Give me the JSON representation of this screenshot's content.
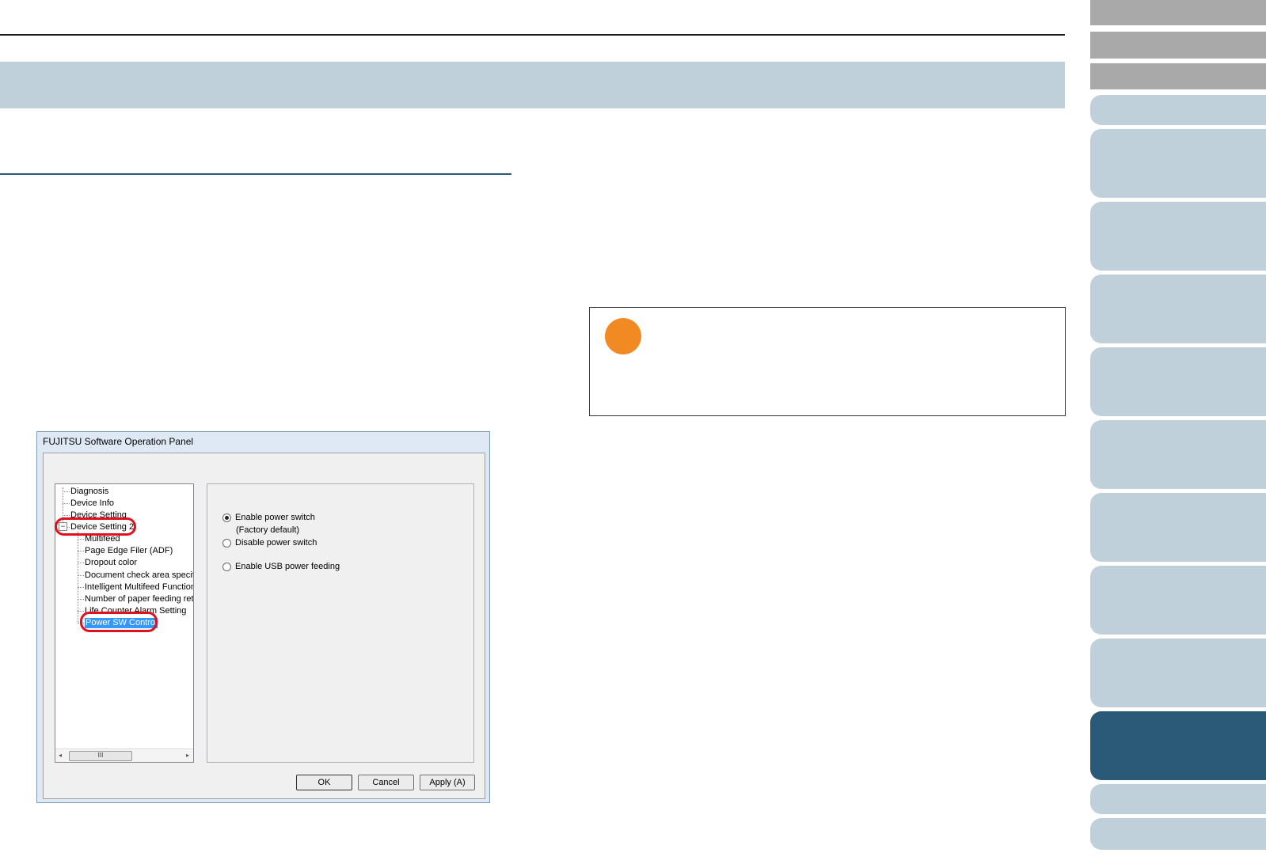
{
  "dialog": {
    "title": "FUJITSU Software Operation Panel",
    "tree_items": [
      "Diagnosis",
      "Device Info",
      "Device Setting",
      "Device Setting 2",
      "Multifeed",
      "Page Edge Filer (ADF)",
      "Dropout color",
      "Document check area specific",
      "Intelligent Multifeed Function",
      "Number of paper feeding retrie",
      "Life Counter Alarm Setting",
      "Power SW Control"
    ],
    "expander": "−",
    "scroll_thumb": "III",
    "scroll_left": "◂",
    "scroll_right": "▸",
    "options": {
      "enable_power_switch": "Enable power switch",
      "factory_default": "(Factory default)",
      "disable_power_switch": "Disable power switch",
      "enable_usb_power_feeding": "Enable USB power feeding"
    },
    "selected_option": "enable_power_switch",
    "buttons": {
      "ok": "OK",
      "cancel": "Cancel",
      "apply": "Apply (A)"
    }
  },
  "colors": {
    "band": "#bfd0da",
    "active_tab": "#2b5a78",
    "note_icon": "#f28a24",
    "highlight": "#e0101e"
  }
}
